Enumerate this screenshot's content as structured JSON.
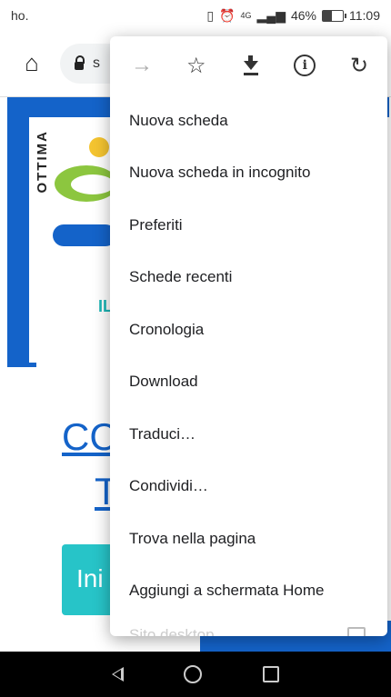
{
  "status_bar": {
    "left_text": "ho.",
    "battery_pct": "46%",
    "time": "11:09",
    "network": "4G"
  },
  "toolbar": {
    "url_partial": "s"
  },
  "page_behind": {
    "logo_text": "OTTIMA",
    "logo_subtext": "IL",
    "heading_line1": "CC",
    "heading_line2": "T",
    "button_text": "Ini"
  },
  "menu": {
    "icon_row": [
      {
        "name": "forward-icon",
        "glyph": "→"
      },
      {
        "name": "star-icon",
        "glyph": "☆"
      },
      {
        "name": "download-icon",
        "glyph": ""
      },
      {
        "name": "info-icon",
        "glyph": "i"
      },
      {
        "name": "refresh-icon",
        "glyph": "C"
      }
    ],
    "items": [
      "Nuova scheda",
      "Nuova scheda in incognito",
      "Preferiti",
      "Schede recenti",
      "Cronologia",
      "Download",
      "Traduci…",
      "Condividi…",
      "Trova nella pagina",
      "Aggiungi a schermata Home",
      "Sito desktop"
    ]
  }
}
